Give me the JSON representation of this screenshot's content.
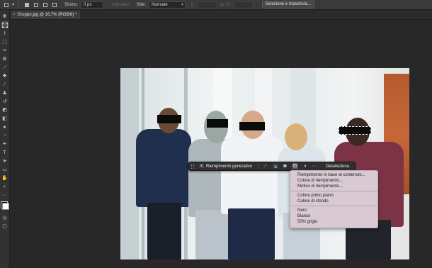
{
  "optionsbar": {
    "feather_label": "Sfumo:",
    "feather_value": "0 px",
    "antialias_label": "Anti-alias",
    "style_label": "Stile:",
    "style_value": "Normale",
    "width_label": "L:",
    "height_label": "A:",
    "select_mask_button": "Selezione e maschera..."
  },
  "document": {
    "tab_title": "Gruppo.jpg @ 16,7% (RGB/8) *",
    "close_glyph": "×"
  },
  "tools": [
    "move-icon",
    "marquee-icon",
    "lasso-icon",
    "object-select-icon",
    "crop-icon",
    "frame-icon",
    "eyedropper-icon",
    "healing-icon",
    "brush-icon",
    "stamp-icon",
    "history-brush-icon",
    "eraser-icon",
    "gradient-icon",
    "blur-icon",
    "dodge-icon",
    "pen-icon",
    "type-icon",
    "path-select-icon",
    "rectangle-icon",
    "hand-icon",
    "zoom-icon",
    "more-icon"
  ],
  "taskbar": {
    "generative_fill_label": "Riempimento generativo",
    "deselect_label": "Deseleziona"
  },
  "fill_menu": {
    "group1": [
      "Riempimento in base al contenuto...",
      "Colore di riempimento...",
      "Motivo di riempimento..."
    ],
    "group2": [
      "Colore primo piano",
      "Colore di sfondo"
    ],
    "group3": [
      "Nero",
      "Bianco",
      "50% grigio"
    ]
  },
  "colors": {
    "foreground": "#000000",
    "background": "#ffffff",
    "menu_bg": "#d8c9d3"
  }
}
